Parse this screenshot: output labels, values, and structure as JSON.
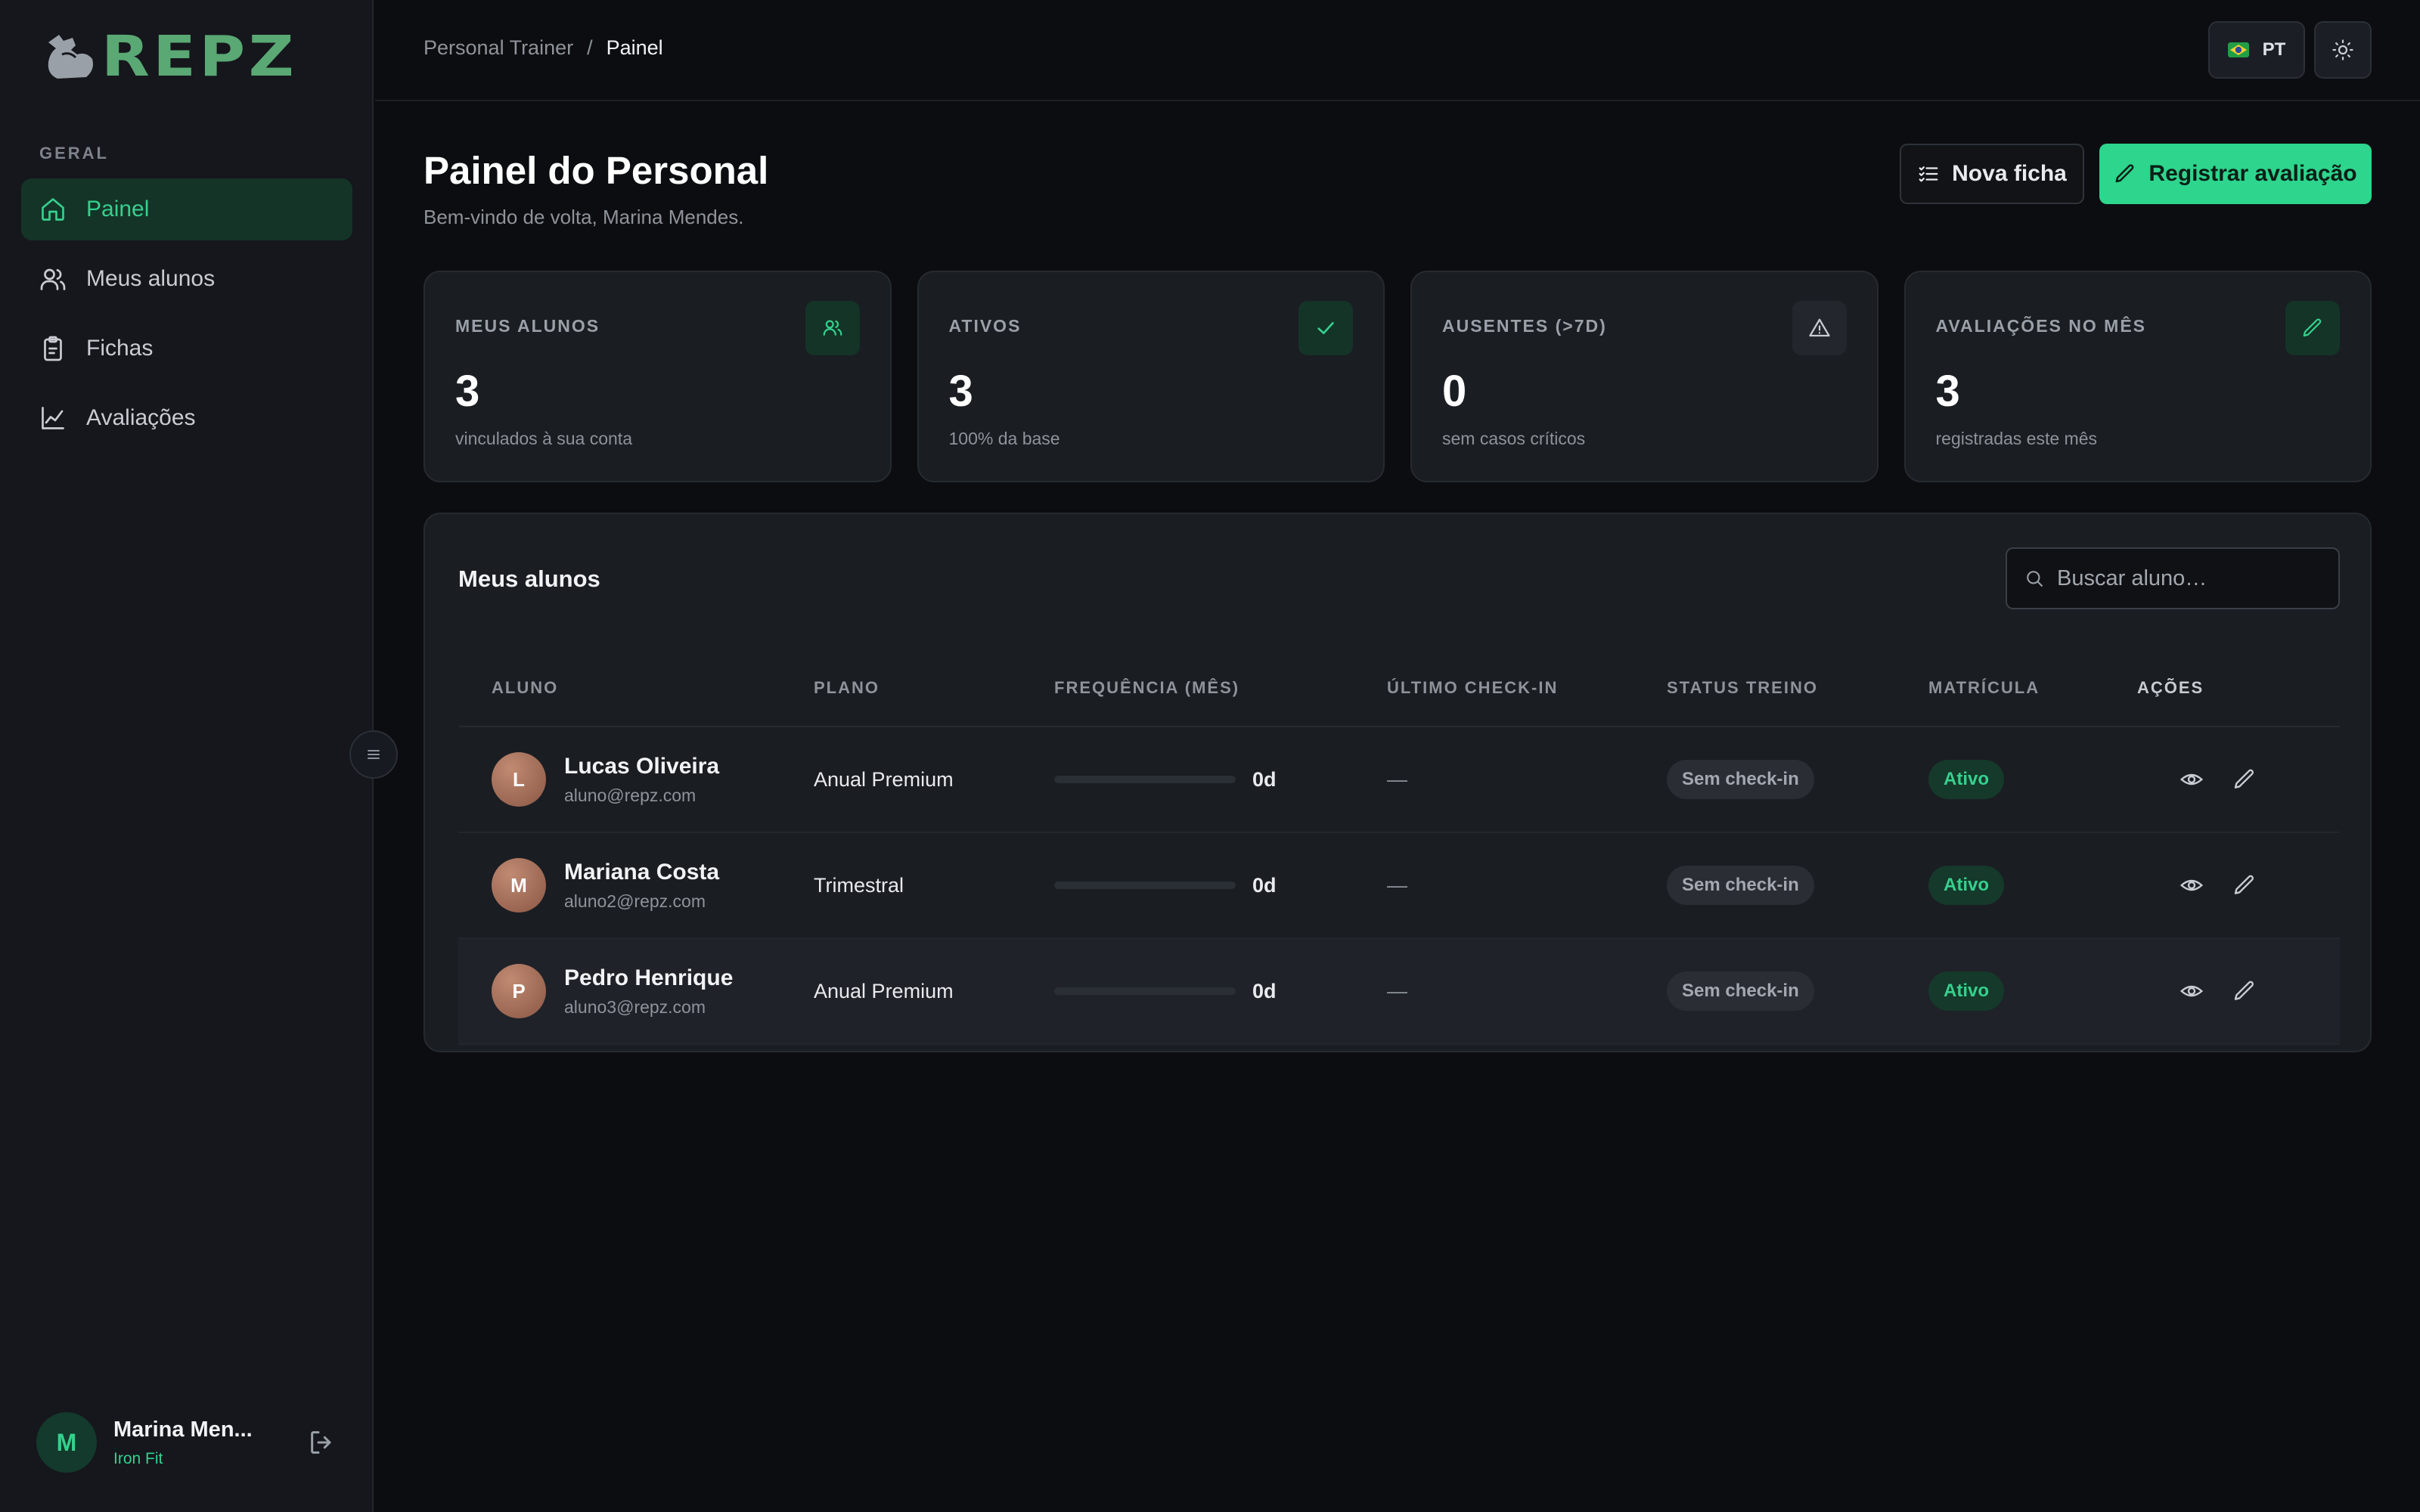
{
  "app": {
    "logo_text": "REPZ",
    "colors": {
      "accent": "#2dd58d",
      "accent_text": "#36d08e",
      "background": "#0c0d10",
      "surface": "#1a1d22"
    }
  },
  "sidebar": {
    "section_label": "GERAL",
    "items": [
      {
        "label": "Painel",
        "icon": "home-icon",
        "active": true
      },
      {
        "label": "Meus alunos",
        "icon": "users-icon",
        "active": false
      },
      {
        "label": "Fichas",
        "icon": "clipboard-icon",
        "active": false
      },
      {
        "label": "Avaliações",
        "icon": "chart-line-icon",
        "active": false
      }
    ],
    "user": {
      "initial": "M",
      "name": "Marina Men...",
      "org": "Iron Fit"
    }
  },
  "topbar": {
    "breadcrumb": {
      "parent": "Personal Trainer",
      "separator": "/",
      "current": "Painel"
    },
    "language": "PT"
  },
  "header": {
    "title": "Painel do Personal",
    "subtitle": "Bem-vindo de volta, Marina Mendes.",
    "new_sheet_label": "Nova ficha",
    "register_label": "Registrar avaliação"
  },
  "stats": [
    {
      "label": "MEUS ALUNOS",
      "value": "3",
      "desc": "vinculados à sua conta",
      "icon": "users-icon"
    },
    {
      "label": "ATIVOS",
      "value": "3",
      "desc": "100% da base",
      "icon": "check-icon"
    },
    {
      "label": "AUSENTES (>7D)",
      "value": "0",
      "desc": "sem casos críticos",
      "icon": "warning-icon"
    },
    {
      "label": "AVALIAÇÕES NO MÊS",
      "value": "3",
      "desc": "registradas este mês",
      "icon": "pencil-icon"
    }
  ],
  "students": {
    "title": "Meus alunos",
    "search_placeholder": "Buscar aluno…",
    "columns": [
      "ALUNO",
      "PLANO",
      "FREQUÊNCIA (MÊS)",
      "ÚLTIMO CHECK-IN",
      "STATUS TREINO",
      "MATRÍCULA",
      "AÇÕES"
    ],
    "rows": [
      {
        "initial": "L",
        "name": "Lucas Oliveira",
        "email": "aluno@repz.com",
        "plan": "Anual Premium",
        "frequency": 0,
        "frequency_label": "0d",
        "last_checkin": "—",
        "status": "Sem check-in",
        "enrollment": "Ativo"
      },
      {
        "initial": "M",
        "name": "Mariana Costa",
        "email": "aluno2@repz.com",
        "plan": "Trimestral",
        "frequency": 0,
        "frequency_label": "0d",
        "last_checkin": "—",
        "status": "Sem check-in",
        "enrollment": "Ativo"
      },
      {
        "initial": "P",
        "name": "Pedro Henrique",
        "email": "aluno3@repz.com",
        "plan": "Anual Premium",
        "frequency": 0,
        "frequency_label": "0d",
        "last_checkin": "—",
        "status": "Sem check-in",
        "enrollment": "Ativo"
      }
    ]
  }
}
